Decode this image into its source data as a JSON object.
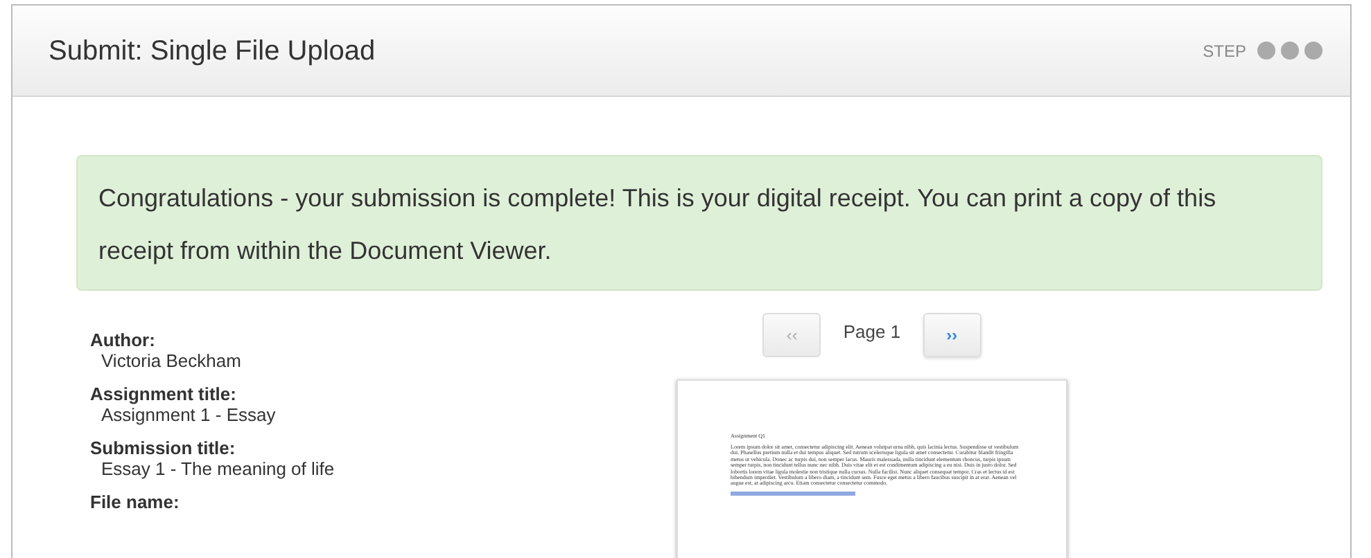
{
  "panel": {
    "title": "Submit: Single File Upload",
    "step_label": "STEP"
  },
  "alert": {
    "text": "Congratulations - your submission is complete! This is your digital receipt. You can print a copy of this receipt from within the Document Viewer."
  },
  "details": [
    {
      "label": "Author:",
      "value": "Victoria Beckham"
    },
    {
      "label": "Assignment title:",
      "value": "Assignment 1 - Essay"
    },
    {
      "label": "Submission title:",
      "value": "Essay 1 - The meaning of life"
    },
    {
      "label": "File name:"
    }
  ],
  "viewer": {
    "prev": {
      "label": "‹‹",
      "disabled": true
    },
    "page": "Page 1",
    "next": {
      "label": "››",
      "disabled": false
    },
    "document": {
      "heading": "Assignment Q1",
      "body": "Lorem ipsum dolor sit amet, consectetur adipiscing elit. Aenean volutpat urna nibh, quis lacinia lectus. Suspendisse ut vestibulum dui. Phasellus pretium nulla et dui tempus aliquet. Sed rutrum scelerisque ligula sit amet consectetur. Curabitur blandit fringilla metus ut vehicula. Donec ac turpis dui, non semper lacus. Mauris malesuada, nulla tincidunt elementum rhoncus, turpis ipsum semper turpis, non tincidunt tellus nunc nec nibh. Duis vitae elit et est condimentum adipiscing a eu nisi. Duis in justo dolor. Sed lobortis lorem vitae ligula molestie non tristique nulla cursus. Nulla facilisi. Nunc aliquet consequat tempor. Cras et lectus id est bibendum imperdiet. Vestibulum a libero diam, a tincidunt sem. Fusce eget metus a libero faucibus suscipit in at erat. Aenean vel augue est, at adipiscing arcu. Etiam consectetur consectetur commodo."
    }
  }
}
